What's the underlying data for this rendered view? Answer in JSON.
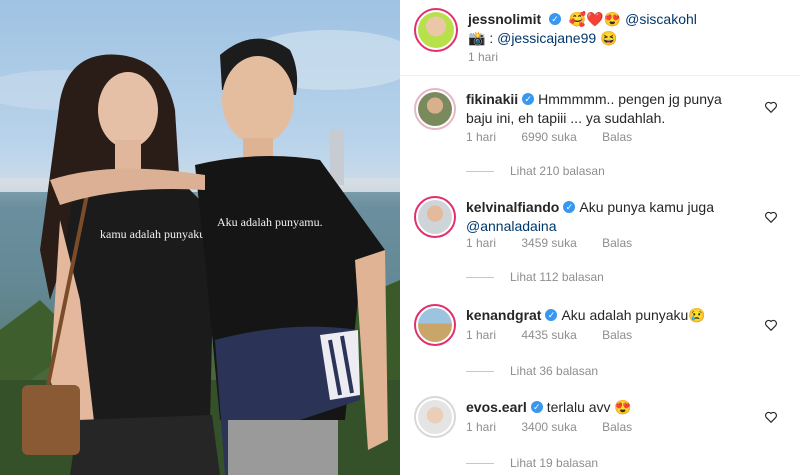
{
  "post": {
    "author": "jessnolimit",
    "caption_emojis": "🥰❤️😍",
    "caption_mention1": "@siscakohl",
    "caption_camera": "📸 :",
    "caption_mention2": "@jessicajane99",
    "caption_end_emoji": "😆",
    "time": "1 hari"
  },
  "photo": {
    "shirt_left_text": "kamu adalah punyaku",
    "shirt_right_text": "Aku adalah punyamu."
  },
  "comments": [
    {
      "username": "fikinakii",
      "text_line1": "Hmmmmm.. pengen jg punya",
      "text_line2": "baju ini, eh tapiii ... ya sudahlah.",
      "time": "1 hari",
      "likes": "6990 suka",
      "reply_label": "Balas",
      "view_replies": "Lihat 210 balasan"
    },
    {
      "username": "kelvinalfiando",
      "text_line1": "Aku punya kamu juga",
      "text_line2": "@annaladaina",
      "time": "1 hari",
      "likes": "3459 suka",
      "reply_label": "Balas",
      "view_replies": "Lihat 112 balasan"
    },
    {
      "username": "kenandgrat",
      "text_line1": "Aku adalah punyaku😢",
      "time": "1 hari",
      "likes": "4435 suka",
      "reply_label": "Balas",
      "view_replies": "Lihat 36 balasan"
    },
    {
      "username": "evos.earl",
      "text_line1": "terlalu avv 😍",
      "time": "1 hari",
      "likes": "3400 suka",
      "reply_label": "Balas",
      "view_replies": "Lihat 19 balasan"
    }
  ],
  "colors": {
    "story_ring": "#e1306c",
    "verified": "#3897f0",
    "mention": "#00376b"
  }
}
